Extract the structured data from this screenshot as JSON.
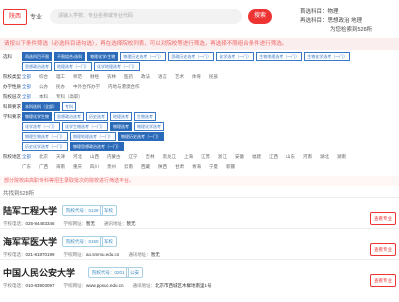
{
  "header": {
    "province_label": "陕西",
    "keyword_label": "专业",
    "search_placeholder": "请输入学校、专业名称或专业代码",
    "search_button": "搜索",
    "subject_first": "首选科目：物理",
    "subject_second": "再选科目：思想政治 地理",
    "score_text": "为您检索到528所"
  },
  "hint_text": "请按以下条件筛选（必选科目请勾选），再在选择院校列表，可以对院校等进行筛选，再选择不限组合条件进行筛选。",
  "filters": [
    {
      "label": "选科",
      "options": [
        {
          "text": "再选科目不限",
          "sel": true
        },
        {
          "text": "不限组合/选科",
          "sel": true
        },
        {
          "text": "物理化学/生物",
          "sel": true
        },
        {
          "text": "物理历史选考（一门）",
          "sel": false
        },
        {
          "text": "思政历史选考（一门）",
          "sel": false
        },
        {
          "text": "化学选考（一门）",
          "sel": false
        },
        {
          "text": "生物地理选考（一门）",
          "sel": false
        },
        {
          "text": "生物化学选考（一门）",
          "sel": false
        }
      ]
    },
    {
      "label": "",
      "options": [
        {
          "text": "思想政治选考",
          "sel": false
        },
        {
          "text": "地理选考（一门）",
          "sel": false
        },
        {
          "text": "化学地理选考（一门）",
          "sel": false
        }
      ]
    },
    {
      "label": "院校类型",
      "options": [
        {
          "text": "全部",
          "sel": true
        },
        {
          "text": "综合",
          "sel": false
        },
        {
          "text": "理工",
          "sel": false
        },
        {
          "text": "师范",
          "sel": false
        },
        {
          "text": "财经",
          "sel": false
        },
        {
          "text": "农林",
          "sel": false
        },
        {
          "text": "医药",
          "sel": false
        },
        {
          "text": "政法",
          "sel": false
        },
        {
          "text": "语言",
          "sel": false
        },
        {
          "text": "艺术",
          "sel": false
        },
        {
          "text": "体育",
          "sel": false
        },
        {
          "text": "民族",
          "sel": false
        }
      ]
    },
    {
      "label": "办学性质",
      "options": [
        {
          "text": "全部",
          "sel": true
        },
        {
          "text": "公办",
          "sel": false
        },
        {
          "text": "民办",
          "sel": false
        },
        {
          "text": "中外合作办学",
          "sel": false
        },
        {
          "text": "内地与港澳合作",
          "sel": false
        }
      ]
    },
    {
      "label": "院校层次",
      "options": [
        {
          "text": "全部",
          "sel": true
        },
        {
          "text": "本科",
          "sel": false
        },
        {
          "text": "专科（高职）",
          "sel": false
        }
      ]
    },
    {
      "label": "科目要求",
      "options": [
        {
          "text": "本科选科（全部）",
          "sel": true
        },
        {
          "text": "专科",
          "sel": false
        }
      ]
    },
    {
      "label": "学科要求",
      "options": [
        {
          "text": "物理化学生物",
          "sel": true
        },
        {
          "text": "思想政治选考",
          "sel": false
        },
        {
          "text": "历史选考",
          "sel": false
        },
        {
          "text": "地理选考",
          "sel": false
        },
        {
          "text": "生物选考",
          "sel": false
        }
      ]
    },
    {
      "label": "",
      "options": [
        {
          "text": "化学选考（一门）",
          "sel": false
        },
        {
          "text": "化学生物选考（一门）",
          "sel": false
        },
        {
          "text": "物理选考",
          "sel": true
        },
        {
          "text": "物理化学选考",
          "sel": false
        }
      ]
    },
    {
      "label": "",
      "options": [
        {
          "text": "物理生物选考（一门）",
          "sel": false
        },
        {
          "text": "物理地理选考（一门）",
          "sel": false
        },
        {
          "text": "物理历史选考（一门）",
          "sel": true
        }
      ]
    },
    {
      "label": "",
      "options": [
        {
          "text": "历史化学选考（一门）",
          "sel": false
        },
        {
          "text": "物理思想政治选考（一门）",
          "sel": true
        }
      ]
    },
    {
      "label": "院校地区",
      "options": [
        {
          "text": "全部",
          "sel": true
        },
        {
          "text": "北京",
          "sel": false
        },
        {
          "text": "天津",
          "sel": false
        },
        {
          "text": "河北",
          "sel": false
        },
        {
          "text": "山西",
          "sel": false
        },
        {
          "text": "内蒙古",
          "sel": false
        },
        {
          "text": "辽宁",
          "sel": false
        },
        {
          "text": "吉林",
          "sel": false
        },
        {
          "text": "黑龙江",
          "sel": false
        },
        {
          "text": "上海",
          "sel": false
        },
        {
          "text": "江苏",
          "sel": false
        },
        {
          "text": "浙江",
          "sel": false
        },
        {
          "text": "安徽",
          "sel": false
        },
        {
          "text": "福建",
          "sel": false
        },
        {
          "text": "江西",
          "sel": false
        },
        {
          "text": "山东",
          "sel": false
        },
        {
          "text": "河南",
          "sel": false
        },
        {
          "text": "湖北",
          "sel": false
        },
        {
          "text": "湖南",
          "sel": false
        }
      ]
    },
    {
      "label": "",
      "options": [
        {
          "text": "广东",
          "sel": false
        },
        {
          "text": "广西",
          "sel": false
        },
        {
          "text": "海南",
          "sel": false
        },
        {
          "text": "重庆",
          "sel": false
        },
        {
          "text": "四川",
          "sel": false
        },
        {
          "text": "贵州",
          "sel": false
        },
        {
          "text": "云南",
          "sel": false
        },
        {
          "text": "西藏",
          "sel": false
        },
        {
          "text": "陕西",
          "sel": false
        },
        {
          "text": "甘肃",
          "sel": false
        },
        {
          "text": "青海",
          "sel": false
        },
        {
          "text": "宁夏",
          "sel": false
        },
        {
          "text": "新疆",
          "sel": false
        }
      ]
    }
  ],
  "notice": "部分院校由高职专科等招生录取批次的院校进行筛选平台。",
  "result_count": "共找到528所",
  "schools": [
    {
      "name": "陆军工程大学",
      "code": "院校代号：0129",
      "tag": "军校",
      "tel_label": "学校电话：",
      "tel": "025-84483346",
      "web_label": "学校网址：",
      "web": "暂无",
      "addr_label": "通讯地址：",
      "addr": "暂无",
      "detail": "查看专业"
    },
    {
      "name": "海军军医大学",
      "code": "院校代号：0150",
      "tag": "军校",
      "tel_label": "学校电话：",
      "tel": "021-81870199",
      "web_label": "学校网址：",
      "web": "ao.smmu.edu.cn",
      "addr_label": "通讯地址：",
      "addr": "暂无",
      "detail": "查看专业"
    },
    {
      "name": "中国人民公安大学",
      "code": "院校代号：0201",
      "tag": "公安",
      "tel_label": "学校电话：",
      "tel": "010-83903097",
      "web_label": "学校网址：",
      "web": "www.ppsuc.edu.cn",
      "addr_label": "通讯地址：",
      "addr": "北京市西城区木樨地南里1号",
      "detail": "查看专业"
    }
  ]
}
